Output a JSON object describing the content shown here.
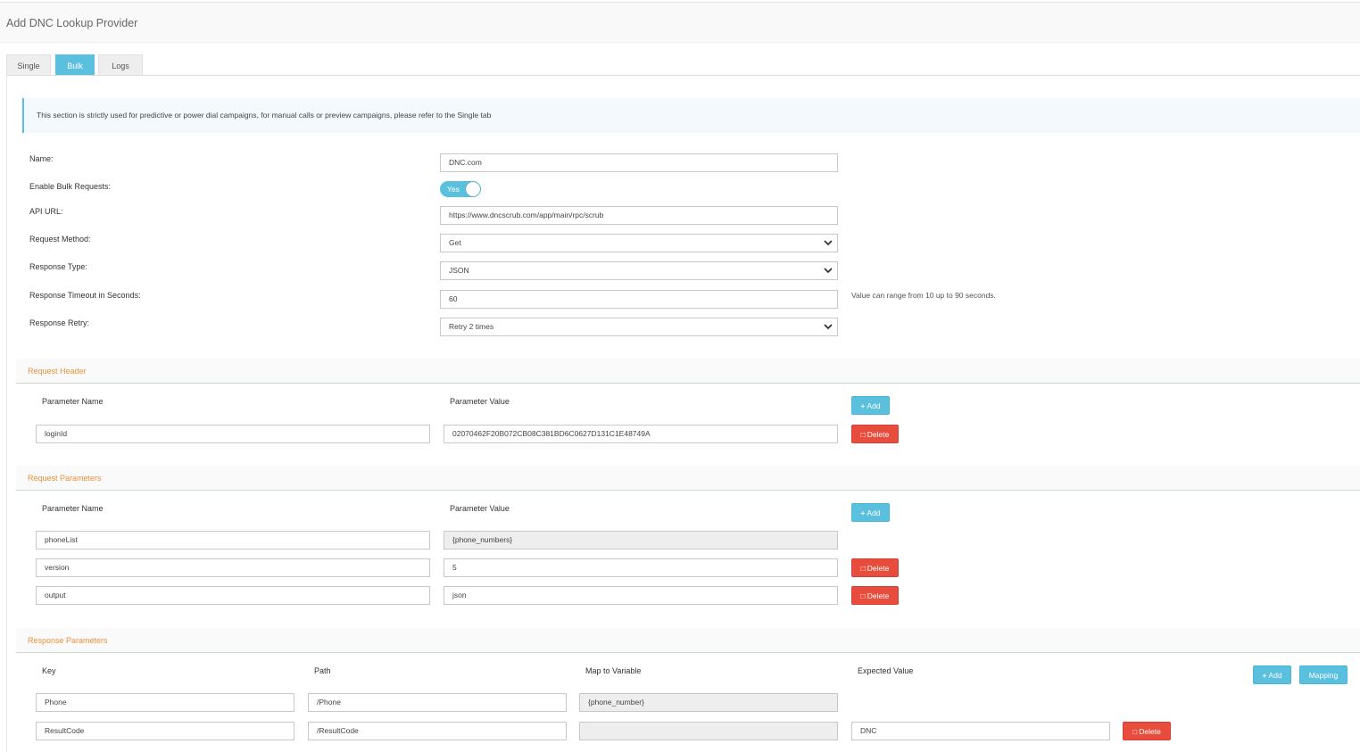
{
  "page": {
    "title": "Add DNC Lookup Provider"
  },
  "tabs": [
    {
      "label": "Single",
      "active": false
    },
    {
      "label": "Bulk",
      "active": true
    },
    {
      "label": "Logs",
      "active": false
    }
  ],
  "alert": {
    "text": "This section is strictly used for predictive or power dial campaigns, for manual calls or preview campaigns, please refer to the Single tab"
  },
  "form": {
    "name": {
      "label": "Name:",
      "value": "DNC.com"
    },
    "enable_bulk": {
      "label": "Enable Bulk Requests:",
      "toggle_text": "Yes",
      "on": true
    },
    "api_url": {
      "label": "API URL:",
      "value": "https://www.dncscrub.com/app/main/rpc/scrub"
    },
    "request_method": {
      "label": "Request Method:",
      "value": "Get"
    },
    "response_type": {
      "label": "Response Type:",
      "value": "JSON"
    },
    "response_timeout": {
      "label": "Response Timeout in Seconds:",
      "value": "60",
      "help": "Value can range from 10 up to 90 seconds."
    },
    "response_retry": {
      "label": "Response Retry:",
      "value": "Retry 2 times"
    }
  },
  "request_header": {
    "title": "Request Header",
    "col_name": "Parameter Name",
    "col_value": "Parameter Value",
    "add_label": "Add",
    "rows": [
      {
        "name": "loginId",
        "value": "02070462F20B072CB08C381BD6C0627D131C1E48749A",
        "delete_label": "Delete"
      }
    ]
  },
  "request_params": {
    "title": "Request Parameters",
    "col_name": "Parameter Name",
    "col_value": "Parameter Value",
    "add_label": "Add",
    "rows": [
      {
        "name": "phoneList",
        "value": "{phone_numbers}"
      },
      {
        "name": "version",
        "value": "5",
        "delete_label": "Delete"
      },
      {
        "name": "output",
        "value": "json",
        "delete_label": "Delete"
      }
    ]
  },
  "response_params": {
    "title": "Response Parameters",
    "col_key": "Key",
    "col_path": "Path",
    "col_map": "Map to Variable",
    "col_expected": "Expected Value",
    "add_label": "Add",
    "mapping_label": "Mapping",
    "rows": [
      {
        "key": "Phone",
        "path": "/Phone",
        "map": "{phone_number}"
      },
      {
        "key": "ResultCode",
        "path": "/ResultCode",
        "map": "",
        "expected": "DNC",
        "delete_label": "Delete"
      }
    ]
  },
  "colors": {
    "accent": "#5bc0de",
    "danger": "#e74c3c",
    "section_title": "#e8913a"
  }
}
